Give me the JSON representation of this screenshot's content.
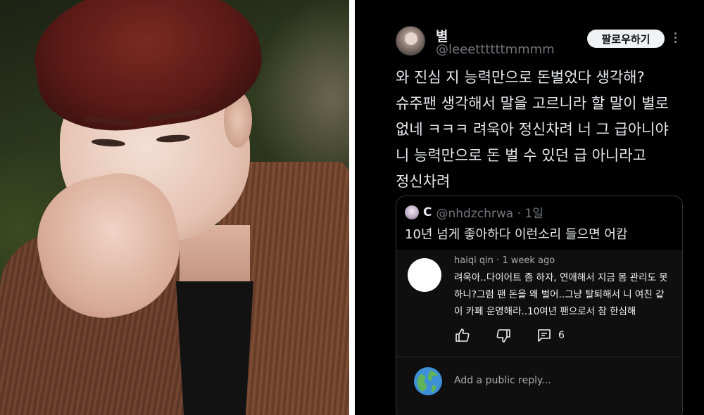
{
  "tweet": {
    "author_name": "별",
    "author_handle": "@leeettttttmmmm",
    "follow_label": "팔로우하기",
    "more_icon": "more-vertical-icon",
    "text_lines": [
      "와 진심 지 능력만으로 돈벌었다 생각해?",
      "슈주팬 생각해서 말을 고르니라 할 말이 별로",
      "없네 ㅋㅋㅋ 려욱아 정신차려 너 그 급아니야",
      "니 능력만으로 돈 벌 수 있던 급 아니라고",
      "정신차려"
    ]
  },
  "quote": {
    "name": "C",
    "handle": "@nhdzchrwa · 1일",
    "text": "10년 넘게 좋아하다 이런소리 들으면 어캄"
  },
  "comment": {
    "author": "haiqi qin · 1 week ago",
    "lines": [
      "려욱아..다이어트 좀 하자, 연애해서 지금 몸 관리도 못",
      "하니?그럼 팬 돈을 왜 벌어..그냥 탈퇴해서 니 여친 같",
      "이 카페 운영해라..10여년 팬으로서 참 한심해"
    ],
    "reply_count": "6",
    "reply_placeholder": "Add a public reply..."
  },
  "colors": {
    "background": "#000000",
    "comment_bg": "#0f0f0f",
    "text": "#e7e9ea",
    "muted": "#71767b"
  }
}
